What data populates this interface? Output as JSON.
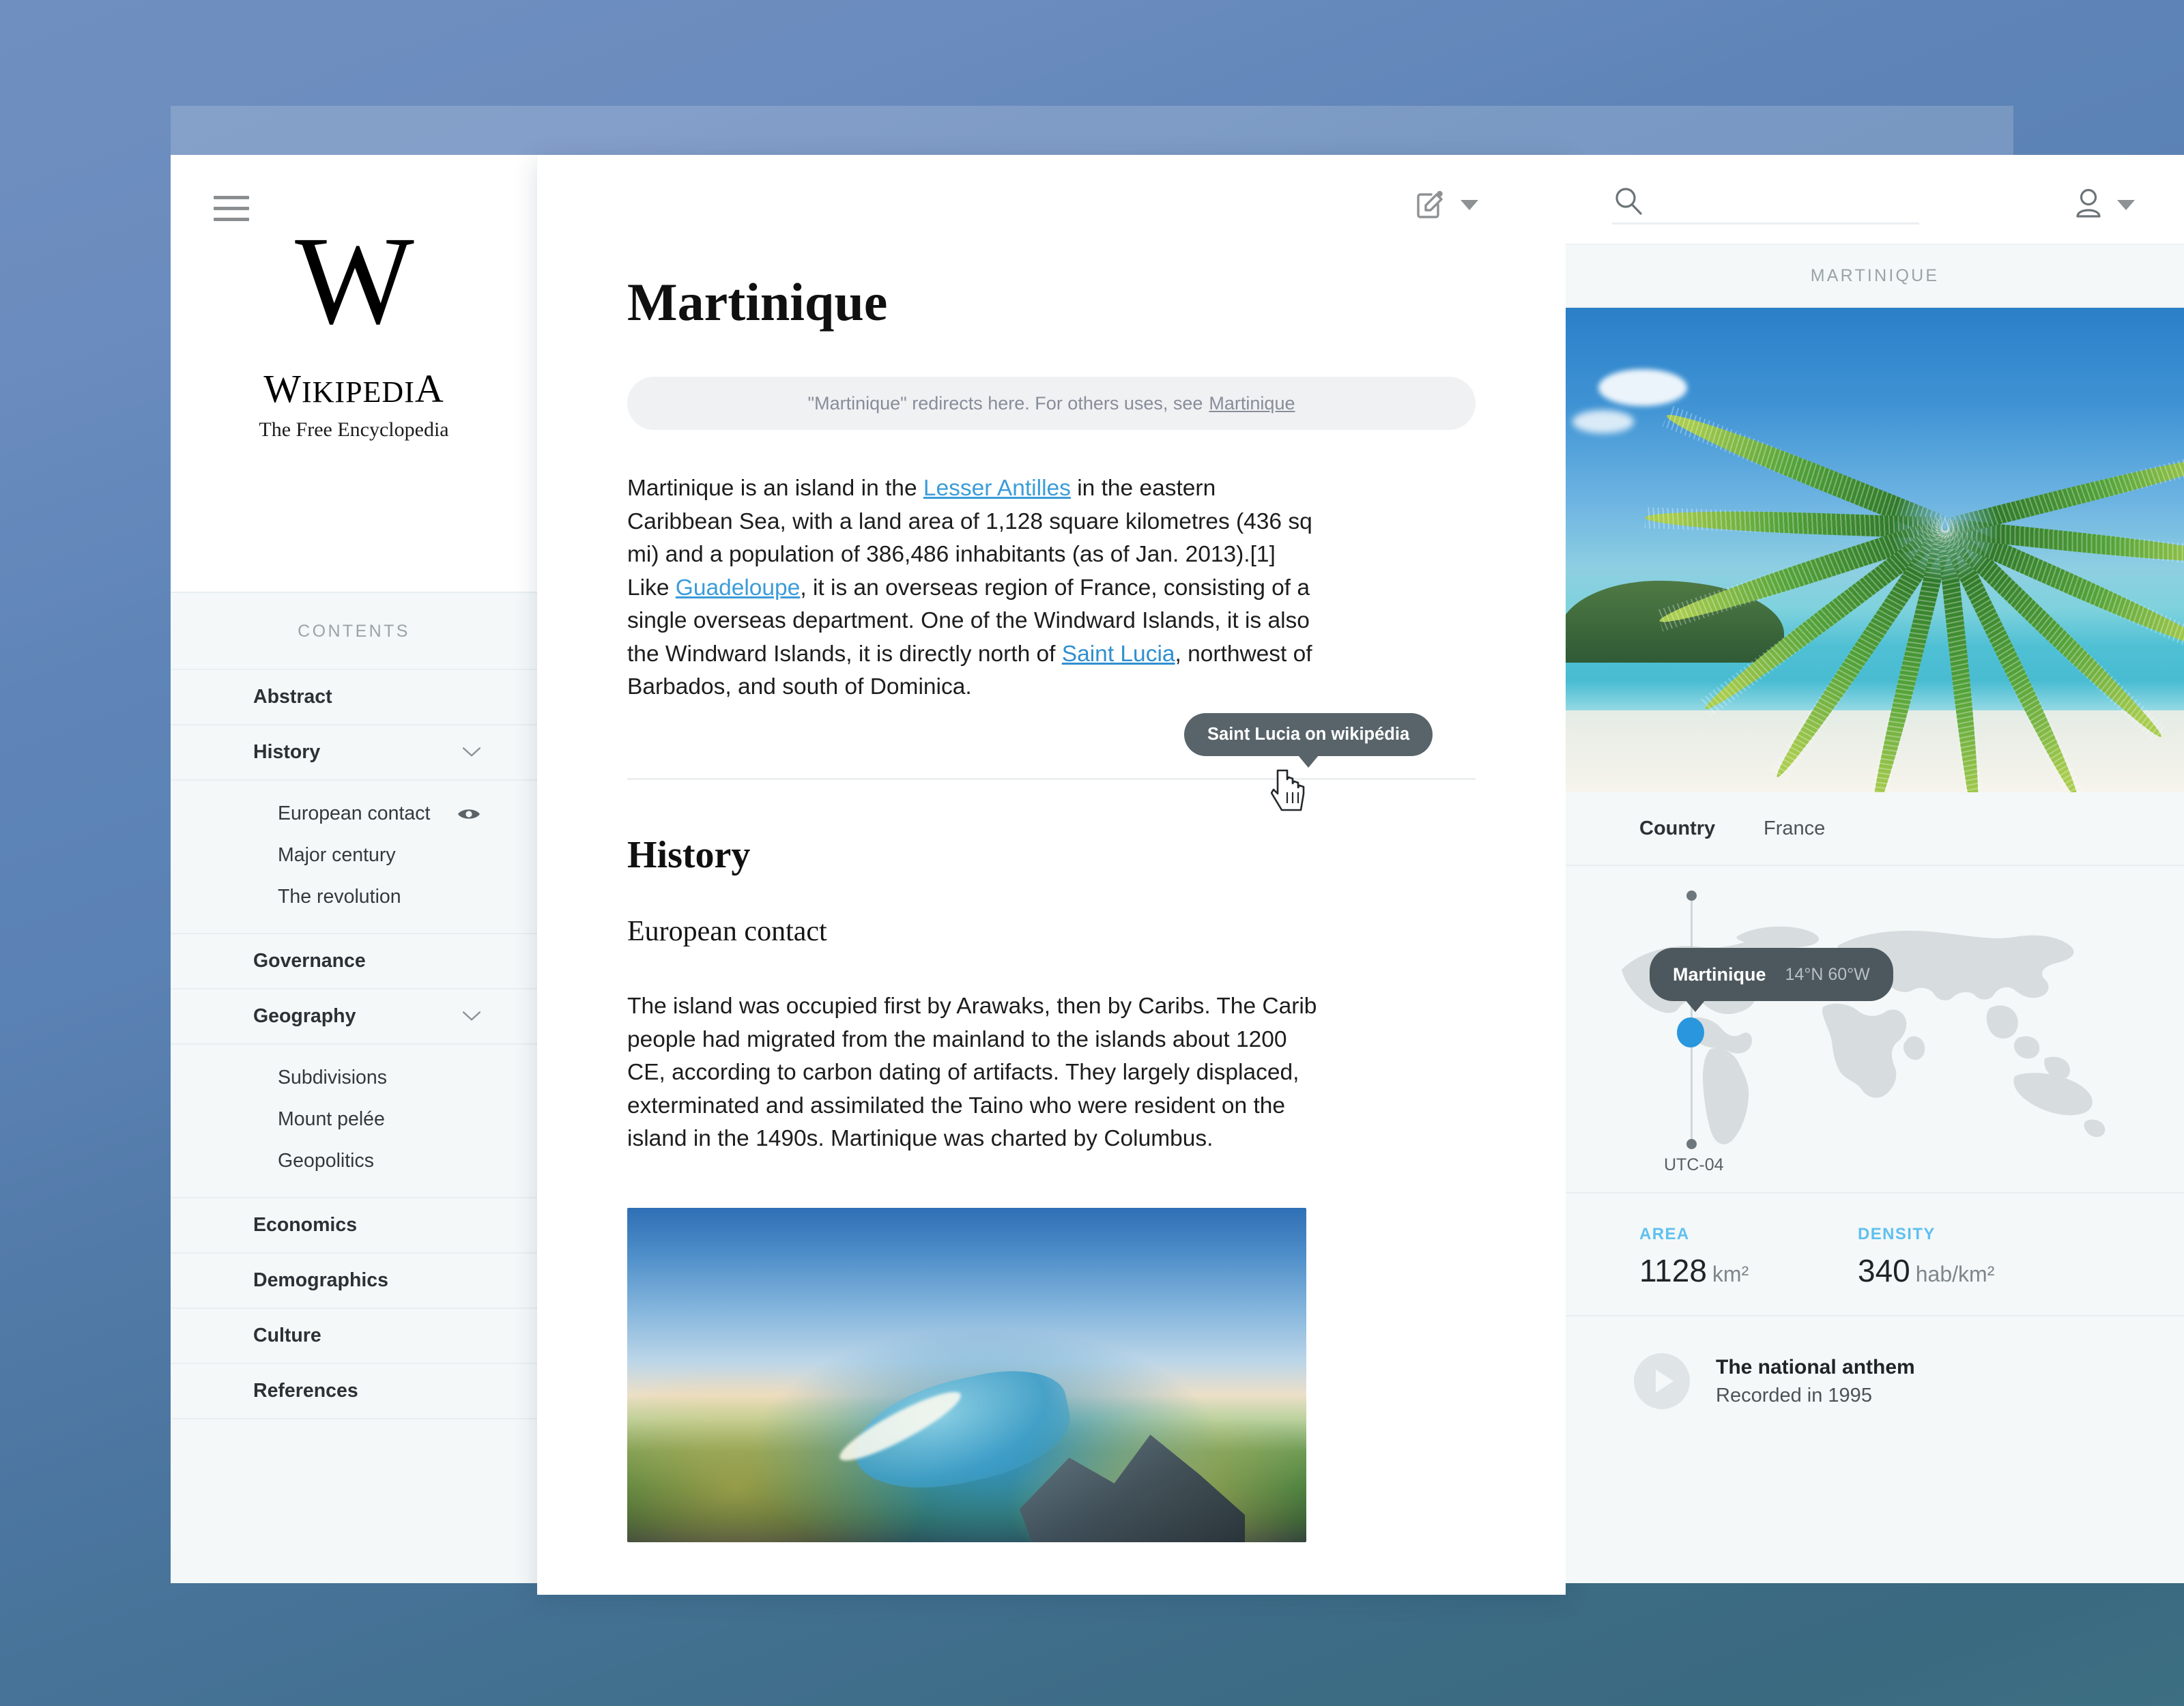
{
  "sidebar": {
    "menu_icon": "hamburger-icon",
    "logo": {
      "monogram": "W",
      "name_cap": "W",
      "name_rest": "IKIPEDI",
      "name_last": "A",
      "tagline": "The Free Encyclopedia"
    },
    "contents_label": "CONTENTS",
    "items": [
      {
        "label": "Abstract",
        "type": "section",
        "expandable": false
      },
      {
        "label": "History",
        "type": "section",
        "expandable": true
      },
      {
        "label": "European contact",
        "type": "sub",
        "active": true
      },
      {
        "label": "Major century",
        "type": "sub",
        "active": false
      },
      {
        "label": "The revolution",
        "type": "sub",
        "active": false
      },
      {
        "label": "Governance",
        "type": "section",
        "expandable": false
      },
      {
        "label": "Geography",
        "type": "section",
        "expandable": true
      },
      {
        "label": "Subdivisions",
        "type": "sub",
        "active": false
      },
      {
        "label": "Mount pelée",
        "type": "sub",
        "active": false
      },
      {
        "label": "Geopolitics",
        "type": "sub",
        "active": false
      },
      {
        "label": "Economics",
        "type": "section",
        "expandable": false
      },
      {
        "label": "Demographics",
        "type": "section",
        "expandable": false
      },
      {
        "label": "Culture",
        "type": "section",
        "expandable": false
      },
      {
        "label": "References",
        "type": "section",
        "expandable": false
      }
    ]
  },
  "toolbar": {
    "edit_icon": "edit-pencil-icon",
    "edit_caret": "caret-down-icon"
  },
  "article": {
    "title": "Martinique",
    "redirect_text": "\"Martinique\" redirects here. For others uses, see",
    "redirect_link": "Martinique",
    "intro": {
      "p1": "Martinique is an island in the ",
      "link1": "Lesser Antilles",
      "p2": " in the eastern Caribbean Sea, with a land area of 1,128 square kilometres (436 sq mi) and a population of 386,486 inhabitants (as of Jan. 2013).[1] Like ",
      "link2": "Guadeloupe",
      "p3": ", it is an overseas region of France, consisting of a single overseas department. One of the Windward Islands, it is also the Windward Islands, it is directly north of ",
      "link3": "Saint Lucia",
      "p4": ", northwest of Barbados, and south of Dominica."
    },
    "section_title": "History",
    "subsection_title": "European contact",
    "body": "The island was occupied first by Arawaks, then by Caribs. The Carib people had migrated from the mainland to the islands about 1200 CE, according to carbon dating of artifacts. They largely displaced, exterminated and assimilated the Taino who were resident on the island in the 1490s. Martinique was charted by Columbus."
  },
  "tooltip": {
    "text": "Saint Lucia on wikipédia"
  },
  "info_panel": {
    "search": {
      "value": "",
      "placeholder": "",
      "icon": "search-icon"
    },
    "user": {
      "icon": "user-avatar-icon",
      "caret": "caret-down-icon"
    },
    "title": "MARTINIQUE",
    "hero_alt": "beach-photo",
    "rows": [
      {
        "key": "Country",
        "value": "France"
      }
    ],
    "map": {
      "pin_label": "Martinique",
      "coordinates": "14°N 60°W",
      "timezone": "UTC-04"
    },
    "stats": [
      {
        "key": "AREA",
        "value": "1128",
        "unit": "km²"
      },
      {
        "key": "DENSITY",
        "value": "340",
        "unit": "hab/km²"
      }
    ],
    "media": {
      "play_icon": "play-icon",
      "title": "The national anthem",
      "subtitle": "Recorded in 1995"
    }
  },
  "colors": {
    "accent_blue": "#3b9cd9",
    "stat_label_blue": "#5fc0ef",
    "tooltip_bg": "#58646a",
    "map_pin": "#2a96dd",
    "panel_bg": "#f4f8f9"
  }
}
